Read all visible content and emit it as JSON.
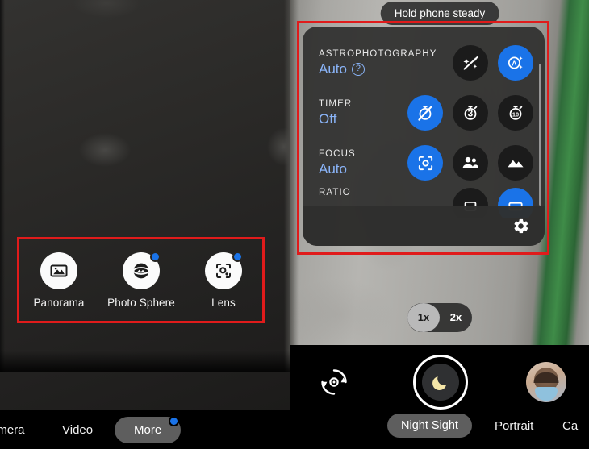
{
  "left_phone": {
    "more_tray": {
      "items": [
        {
          "label": "Panorama",
          "icon": "panorama-icon",
          "badge": false
        },
        {
          "label": "Photo Sphere",
          "icon": "photo-sphere-icon",
          "badge": true
        },
        {
          "label": "Lens",
          "icon": "google-lens-icon",
          "badge": true
        }
      ]
    },
    "mode_bar": {
      "camera_label": "amera",
      "video_label": "Video",
      "more_label": "More",
      "more_badge": true
    }
  },
  "right_phone": {
    "hint": "Hold phone steady",
    "settings_sheet": {
      "rows": [
        {
          "title": "ASTROPHOTOGRAPHY",
          "value": "Auto",
          "help": "?",
          "options": [
            {
              "name": "astro-off-icon",
              "selected": false
            },
            {
              "name": "astro-auto-icon",
              "selected": true
            }
          ]
        },
        {
          "title": "TIMER",
          "value": "Off",
          "options": [
            {
              "name": "timer-off-icon",
              "selected": true
            },
            {
              "name": "timer-3s-icon",
              "label": "3",
              "selected": false
            },
            {
              "name": "timer-10s-icon",
              "label": "10",
              "selected": false
            }
          ]
        },
        {
          "title": "FOCUS",
          "value": "Auto",
          "options": [
            {
              "name": "focus-auto-icon",
              "selected": true
            },
            {
              "name": "focus-people-icon",
              "selected": false
            },
            {
              "name": "focus-landscape-icon",
              "selected": false
            }
          ]
        },
        {
          "title": "RATIO",
          "value": "",
          "options": [
            {
              "name": "ratio-4-3-icon",
              "selected": false
            },
            {
              "name": "ratio-16-9-icon",
              "selected": true
            }
          ]
        }
      ],
      "settings_gear": "settings-gear-icon"
    },
    "zoom": {
      "options": [
        {
          "label": "1x",
          "selected": true
        },
        {
          "label": "2x",
          "selected": false
        }
      ]
    },
    "bottom": {
      "flip_icon": "flip-camera-icon",
      "shutter_icon": "night-sight-moon-icon",
      "thumbnail": "photo-thumbnail",
      "modes": [
        {
          "label": "Night Sight",
          "selected": true
        },
        {
          "label": "Portrait",
          "selected": false
        },
        {
          "label": "Ca",
          "selected": false
        }
      ]
    }
  },
  "annotations": {
    "colors": {
      "highlight": "#e01b1b",
      "accent_blue": "#1a73e8",
      "value_blue": "#8ab4f8"
    },
    "boxes": [
      {
        "name": "left-more-tray-highlight"
      },
      {
        "name": "right-settings-sheet-highlight"
      }
    ]
  }
}
